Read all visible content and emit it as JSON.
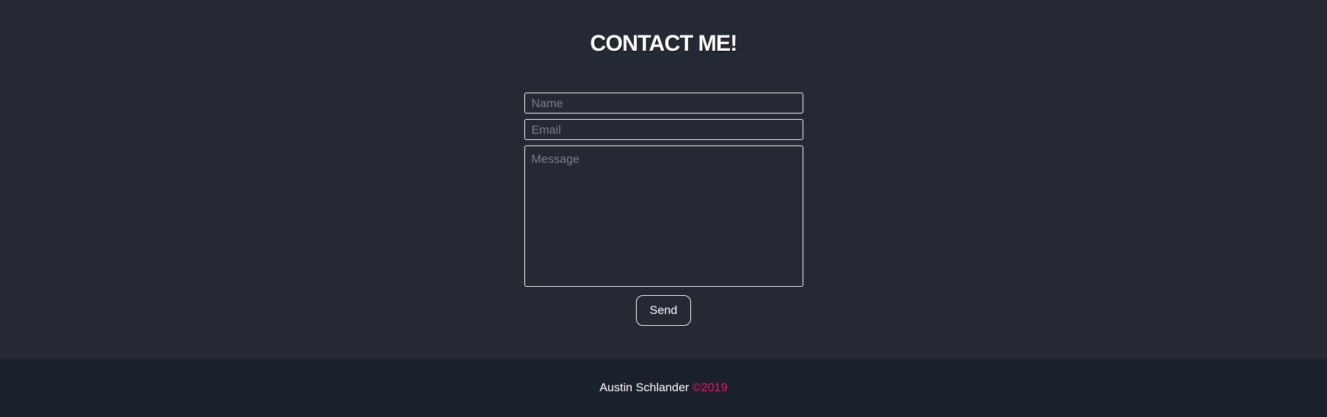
{
  "contact": {
    "title": "CONTACT ME!",
    "name_placeholder": "Name",
    "email_placeholder": "Email",
    "message_placeholder": "Message",
    "send_label": "Send"
  },
  "footer": {
    "author": "Austin Schlander",
    "copyright": "©2019"
  },
  "colors": {
    "background": "#252934",
    "footer_background": "#1b212c",
    "accent": "#e31b6d",
    "text": "#ffffff"
  }
}
